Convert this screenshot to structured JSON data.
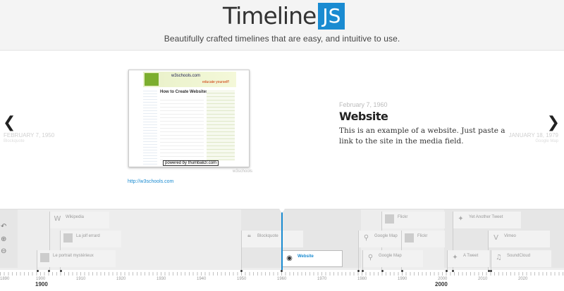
{
  "header": {
    "logo_text": "Timeline",
    "logo_badge": "JS",
    "tagline": "Beautifully crafted timelines that are easy, and intuitive to use."
  },
  "slider": {
    "prev": {
      "date": "FEBRUARY 7, 1950",
      "sub": "Blockquote"
    },
    "next": {
      "date": "JANUARY 18, 1979",
      "sub": "Google Map"
    },
    "slide": {
      "date": "February 7, 1960",
      "title": "Website",
      "text": "This is an example of a website. Just paste a link to the site in the media field.",
      "media_credit": "w3schools",
      "media_link": "http://w3schools.com",
      "thumb": {
        "title": "w3schools.com",
        "slogan": "educate yourself!",
        "heading": "How to Create Websites",
        "powered": "powered by thumbalizr.com"
      }
    }
  },
  "timeline": {
    "flags": [
      {
        "label": "Wikipedia",
        "icon": "wikipedia-icon",
        "glyph": "W"
      },
      {
        "label": "La jolf errard",
        "icon": "image-icon",
        "glyph": ""
      },
      {
        "label": "Le portrait mystérieux",
        "icon": "image-icon",
        "glyph": ""
      },
      {
        "label": "Blockquote",
        "icon": "quote-icon",
        "glyph": "❝"
      },
      {
        "label": "Website",
        "icon": "website-icon",
        "glyph": "◉"
      },
      {
        "label": "Flickr",
        "icon": "image-icon",
        "glyph": ""
      },
      {
        "label": "Google Map",
        "icon": "map-pin-icon",
        "glyph": "⚲"
      },
      {
        "label": "Flickr",
        "icon": "image-icon",
        "glyph": ""
      },
      {
        "label": "Google Map",
        "icon": "map-pin-icon",
        "glyph": "⚲"
      },
      {
        "label": "Yet Another Tweet",
        "icon": "twitter-icon",
        "glyph": "✦"
      },
      {
        "label": "Vimeo",
        "icon": "vimeo-icon",
        "glyph": "V"
      },
      {
        "label": "A Tweet",
        "icon": "twitter-icon",
        "glyph": "✦"
      },
      {
        "label": "SoundCloud",
        "icon": "music-icon",
        "glyph": "♫"
      }
    ],
    "years": [
      "1890",
      "1900",
      "1910",
      "1920",
      "1930",
      "1940",
      "1950",
      "1960",
      "1970",
      "1980",
      "1990",
      "2000",
      "2010",
      "2020"
    ],
    "eras": [
      "1900",
      "2000"
    ]
  },
  "colors": {
    "accent": "#1a8bd1"
  }
}
